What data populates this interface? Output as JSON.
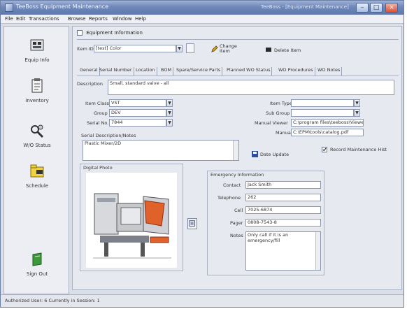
{
  "window": {
    "title": "TeeBoss Equipment Maintenance",
    "title_secondary": "TeeBoss - [Equipment Maintenance]"
  },
  "menu": [
    "File",
    "Edit",
    "Transactions",
    "Browse",
    "Reports",
    "Window",
    "Help"
  ],
  "nav": [
    {
      "label": "Equip Info",
      "icon": "gear-icon"
    },
    {
      "label": "Inventory",
      "icon": "clipboard-icon"
    },
    {
      "label": "W/O Status",
      "icon": "wrench-icon"
    },
    {
      "label": "Schedule",
      "icon": "folder-icon"
    },
    {
      "label": "Sign Out",
      "icon": "book-icon"
    }
  ],
  "panel_title": "Equipment Information",
  "item": {
    "label": "Item ID",
    "value": "[test] Color"
  },
  "actions": {
    "change": "Change Item",
    "delete": "Delete Item"
  },
  "tabs": [
    "General",
    "Serial Number",
    "Location",
    "BOM",
    "Spare/Service Parts",
    "Planned WO Status",
    "WO Procedures",
    "WO Notes"
  ],
  "description": {
    "label": "Description",
    "value": "Small, standard valve - all"
  },
  "left_fields": [
    {
      "label": "Item Class",
      "value": "VST"
    },
    {
      "label": "Group",
      "value": "DEV"
    },
    {
      "label": "Serial No.",
      "value": "7844"
    }
  ],
  "right_fields": [
    {
      "label": "Item Type",
      "value": ""
    },
    {
      "label": "Sub Group",
      "value": ""
    }
  ],
  "manual_viewer": {
    "label": "Manual Viewer",
    "value": "C:\\program files\\teeboss\\Viewer.exe"
  },
  "manual": {
    "label": "Manual",
    "value": "C:\\EPM\\tools\\catalog.pdf"
  },
  "spec_desc": {
    "label": "Serial Description/Notes",
    "value": "Plastic Mixer/2D"
  },
  "date_update": "Date Update",
  "record_maint": "Record Maintenance Hist",
  "photo": {
    "label": "Digital Photo"
  },
  "emergency": {
    "title": "Emergency Information",
    "fields": [
      {
        "label": "Contact",
        "value": "Jack Smith"
      },
      {
        "label": "Telephone",
        "value": "262"
      },
      {
        "label": "Cell",
        "value": "7025-6874"
      },
      {
        "label": "Pager",
        "value": "0808-7543-8"
      },
      {
        "label": "Notes",
        "value": "Only call if it is an emergency/fill"
      }
    ]
  },
  "status": "Authorized User: 6    Currently in Session: 1",
  "colors": {
    "title_bar": "#6f87b9",
    "accent_arrow": "#1f3f8f"
  }
}
